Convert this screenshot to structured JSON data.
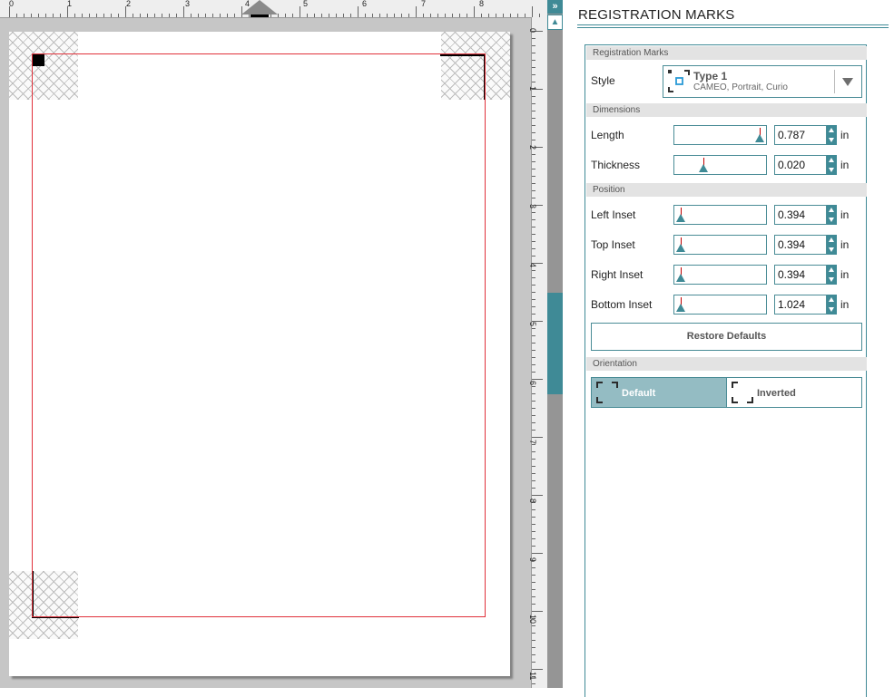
{
  "ruler": {
    "h_labels": [
      "0",
      "1",
      "2",
      "3",
      "4",
      "5",
      "6",
      "7",
      "8"
    ],
    "v_labels": [
      "0",
      "1",
      "2",
      "3",
      "4",
      "5",
      "6",
      "7",
      "8",
      "9",
      "10",
      "11"
    ]
  },
  "panel": {
    "title": "REGISTRATION MARKS",
    "sections": {
      "registration_marks": "Registration Marks",
      "dimensions": "Dimensions",
      "position": "Position",
      "orientation": "Orientation"
    },
    "style": {
      "label": "Style",
      "name": "Type 1",
      "subtitle": "CAMEO, Portrait, Curio",
      "icon": "registration-type1-icon"
    },
    "fields": [
      {
        "key": "length",
        "label": "Length",
        "value": "0.787",
        "unit": "in",
        "slider_pos": 0.97
      },
      {
        "key": "thickness",
        "label": "Thickness",
        "value": "0.020",
        "unit": "in",
        "slider_pos": 0.31
      },
      {
        "key": "left-inset",
        "label": "Left Inset",
        "value": "0.394",
        "unit": "in",
        "slider_pos": 0.04
      },
      {
        "key": "top-inset",
        "label": "Top Inset",
        "value": "0.394",
        "unit": "in",
        "slider_pos": 0.04
      },
      {
        "key": "right-inset",
        "label": "Right Inset",
        "value": "0.394",
        "unit": "in",
        "slider_pos": 0.04
      },
      {
        "key": "bottom-inset",
        "label": "Bottom Inset",
        "value": "1.024",
        "unit": "in",
        "slider_pos": 0.04
      }
    ],
    "restore_label": "Restore Defaults",
    "orientation": {
      "selected": "Default",
      "options": [
        "Default",
        "Inverted"
      ]
    }
  },
  "scrollbar": {
    "expand_icon": "double-chevron-right-icon",
    "expand_glyph": "»",
    "up_glyph": "▲"
  },
  "colors": {
    "accent": "#3f8a96",
    "selected_fill": "#94bcc3",
    "cut_border": "#e0313b",
    "slider_marker": "#c00000",
    "canvas_bg": "#c6c6c6"
  }
}
